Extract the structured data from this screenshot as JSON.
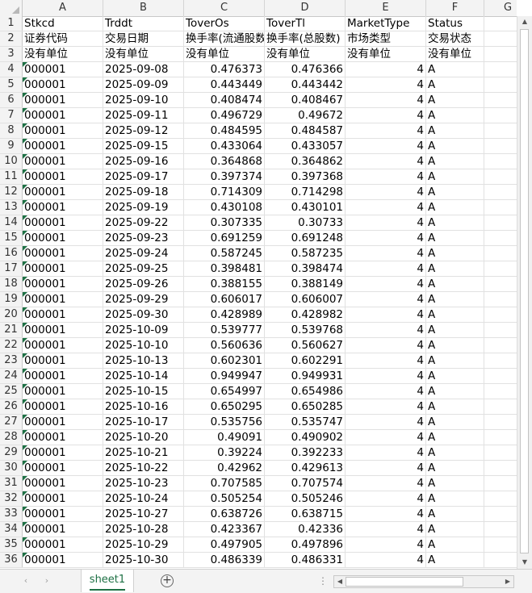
{
  "columns": [
    "A",
    "B",
    "C",
    "D",
    "E",
    "F",
    "G"
  ],
  "header_rows": [
    {
      "row": "1",
      "cells": [
        "Stkcd",
        "Trddt",
        "ToverOs",
        "ToverTl",
        "MarketType",
        "Status"
      ]
    },
    {
      "row": "2",
      "cells": [
        "证券代码",
        "交易日期",
        "换手率(流通股数)",
        "换手率(总股数)",
        "市场类型",
        "交易状态"
      ]
    },
    {
      "row": "3",
      "cells": [
        "没有单位",
        "没有单位",
        "没有单位",
        "没有单位",
        "没有单位",
        "没有单位"
      ]
    }
  ],
  "data_rows": [
    {
      "row": "4",
      "stkcd": "000001",
      "date": "2025-09-08",
      "tover_os": "0.476373",
      "tover_tl": "0.476366",
      "market": "4",
      "status": "A"
    },
    {
      "row": "5",
      "stkcd": "000001",
      "date": "2025-09-09",
      "tover_os": "0.443449",
      "tover_tl": "0.443442",
      "market": "4",
      "status": "A"
    },
    {
      "row": "6",
      "stkcd": "000001",
      "date": "2025-09-10",
      "tover_os": "0.408474",
      "tover_tl": "0.408467",
      "market": "4",
      "status": "A"
    },
    {
      "row": "7",
      "stkcd": "000001",
      "date": "2025-09-11",
      "tover_os": "0.496729",
      "tover_tl": "0.49672",
      "market": "4",
      "status": "A"
    },
    {
      "row": "8",
      "stkcd": "000001",
      "date": "2025-09-12",
      "tover_os": "0.484595",
      "tover_tl": "0.484587",
      "market": "4",
      "status": "A"
    },
    {
      "row": "9",
      "stkcd": "000001",
      "date": "2025-09-15",
      "tover_os": "0.433064",
      "tover_tl": "0.433057",
      "market": "4",
      "status": "A"
    },
    {
      "row": "10",
      "stkcd": "000001",
      "date": "2025-09-16",
      "tover_os": "0.364868",
      "tover_tl": "0.364862",
      "market": "4",
      "status": "A"
    },
    {
      "row": "11",
      "stkcd": "000001",
      "date": "2025-09-17",
      "tover_os": "0.397374",
      "tover_tl": "0.397368",
      "market": "4",
      "status": "A"
    },
    {
      "row": "12",
      "stkcd": "000001",
      "date": "2025-09-18",
      "tover_os": "0.714309",
      "tover_tl": "0.714298",
      "market": "4",
      "status": "A"
    },
    {
      "row": "13",
      "stkcd": "000001",
      "date": "2025-09-19",
      "tover_os": "0.430108",
      "tover_tl": "0.430101",
      "market": "4",
      "status": "A"
    },
    {
      "row": "14",
      "stkcd": "000001",
      "date": "2025-09-22",
      "tover_os": "0.307335",
      "tover_tl": "0.30733",
      "market": "4",
      "status": "A"
    },
    {
      "row": "15",
      "stkcd": "000001",
      "date": "2025-09-23",
      "tover_os": "0.691259",
      "tover_tl": "0.691248",
      "market": "4",
      "status": "A"
    },
    {
      "row": "16",
      "stkcd": "000001",
      "date": "2025-09-24",
      "tover_os": "0.587245",
      "tover_tl": "0.587235",
      "market": "4",
      "status": "A"
    },
    {
      "row": "17",
      "stkcd": "000001",
      "date": "2025-09-25",
      "tover_os": "0.398481",
      "tover_tl": "0.398474",
      "market": "4",
      "status": "A"
    },
    {
      "row": "18",
      "stkcd": "000001",
      "date": "2025-09-26",
      "tover_os": "0.388155",
      "tover_tl": "0.388149",
      "market": "4",
      "status": "A"
    },
    {
      "row": "19",
      "stkcd": "000001",
      "date": "2025-09-29",
      "tover_os": "0.606017",
      "tover_tl": "0.606007",
      "market": "4",
      "status": "A"
    },
    {
      "row": "20",
      "stkcd": "000001",
      "date": "2025-09-30",
      "tover_os": "0.428989",
      "tover_tl": "0.428982",
      "market": "4",
      "status": "A"
    },
    {
      "row": "21",
      "stkcd": "000001",
      "date": "2025-10-09",
      "tover_os": "0.539777",
      "tover_tl": "0.539768",
      "market": "4",
      "status": "A"
    },
    {
      "row": "22",
      "stkcd": "000001",
      "date": "2025-10-10",
      "tover_os": "0.560636",
      "tover_tl": "0.560627",
      "market": "4",
      "status": "A"
    },
    {
      "row": "23",
      "stkcd": "000001",
      "date": "2025-10-13",
      "tover_os": "0.602301",
      "tover_tl": "0.602291",
      "market": "4",
      "status": "A"
    },
    {
      "row": "24",
      "stkcd": "000001",
      "date": "2025-10-14",
      "tover_os": "0.949947",
      "tover_tl": "0.949931",
      "market": "4",
      "status": "A"
    },
    {
      "row": "25",
      "stkcd": "000001",
      "date": "2025-10-15",
      "tover_os": "0.654997",
      "tover_tl": "0.654986",
      "market": "4",
      "status": "A"
    },
    {
      "row": "26",
      "stkcd": "000001",
      "date": "2025-10-16",
      "tover_os": "0.650295",
      "tover_tl": "0.650285",
      "market": "4",
      "status": "A"
    },
    {
      "row": "27",
      "stkcd": "000001",
      "date": "2025-10-17",
      "tover_os": "0.535756",
      "tover_tl": "0.535747",
      "market": "4",
      "status": "A"
    },
    {
      "row": "28",
      "stkcd": "000001",
      "date": "2025-10-20",
      "tover_os": "0.49091",
      "tover_tl": "0.490902",
      "market": "4",
      "status": "A"
    },
    {
      "row": "29",
      "stkcd": "000001",
      "date": "2025-10-21",
      "tover_os": "0.39224",
      "tover_tl": "0.392233",
      "market": "4",
      "status": "A"
    },
    {
      "row": "30",
      "stkcd": "000001",
      "date": "2025-10-22",
      "tover_os": "0.42962",
      "tover_tl": "0.429613",
      "market": "4",
      "status": "A"
    },
    {
      "row": "31",
      "stkcd": "000001",
      "date": "2025-10-23",
      "tover_os": "0.707585",
      "tover_tl": "0.707574",
      "market": "4",
      "status": "A"
    },
    {
      "row": "32",
      "stkcd": "000001",
      "date": "2025-10-24",
      "tover_os": "0.505254",
      "tover_tl": "0.505246",
      "market": "4",
      "status": "A"
    },
    {
      "row": "33",
      "stkcd": "000001",
      "date": "2025-10-27",
      "tover_os": "0.638726",
      "tover_tl": "0.638715",
      "market": "4",
      "status": "A"
    },
    {
      "row": "34",
      "stkcd": "000001",
      "date": "2025-10-28",
      "tover_os": "0.423367",
      "tover_tl": "0.42336",
      "market": "4",
      "status": "A"
    },
    {
      "row": "35",
      "stkcd": "000001",
      "date": "2025-10-29",
      "tover_os": "0.497905",
      "tover_tl": "0.497896",
      "market": "4",
      "status": "A"
    },
    {
      "row": "36",
      "stkcd": "000001",
      "date": "2025-10-30",
      "tover_os": "0.486339",
      "tover_tl": "0.486331",
      "market": "4",
      "status": "A"
    }
  ],
  "bottom_bar": {
    "sheet_tab": "sheet1",
    "add_sheet": "+",
    "prev_sheet_arrow": "‹",
    "next_sheet_arrow": "›",
    "more_dots": "⋮",
    "hscroll_left": "◀",
    "hscroll_right": "▶"
  },
  "vscroll": {
    "up": "▲",
    "down": "▼"
  },
  "colors": {
    "header_bg": "#f3f3f3",
    "gridline": "#e1e1e1",
    "accent_green": "#1e7145"
  }
}
